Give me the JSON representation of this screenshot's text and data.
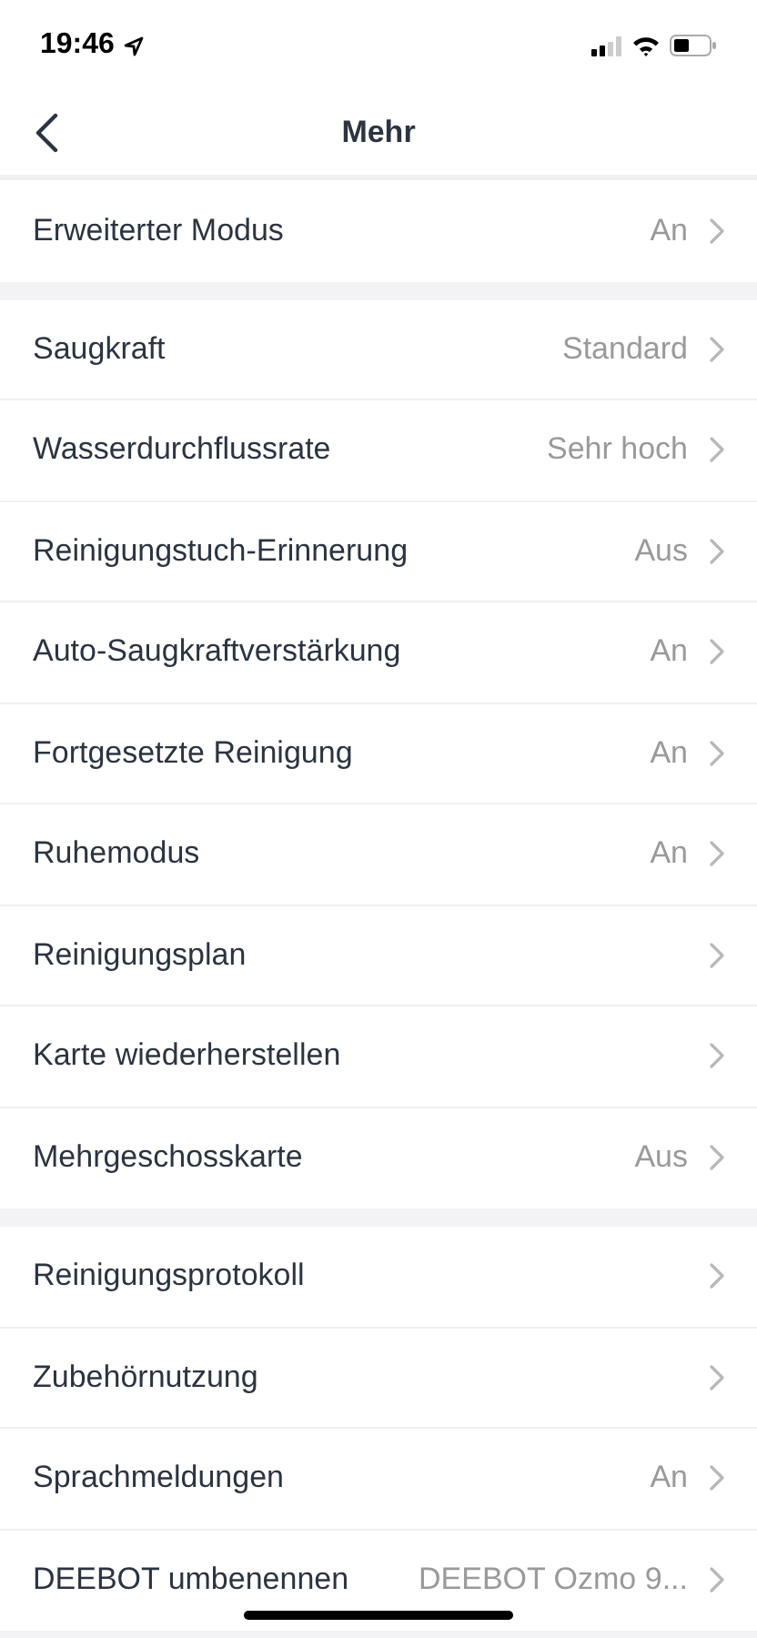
{
  "status_bar": {
    "time": "19:46"
  },
  "nav": {
    "title": "Mehr"
  },
  "groups": [
    {
      "rows": [
        {
          "label": "Erweiterter Modus",
          "value": "An"
        }
      ]
    },
    {
      "rows": [
        {
          "label": "Saugkraft",
          "value": "Standard"
        },
        {
          "label": "Wasserdurchflussrate",
          "value": "Sehr hoch"
        },
        {
          "label": "Reinigungstuch-Erinnerung",
          "value": "Aus"
        },
        {
          "label": "Auto-Saugkraftverstärkung",
          "value": "An"
        },
        {
          "label": "Fortgesetzte Reinigung",
          "value": "An"
        },
        {
          "label": "Ruhemodus",
          "value": "An"
        },
        {
          "label": "Reinigungsplan"
        },
        {
          "label": "Karte wiederherstellen"
        },
        {
          "label": "Mehrgeschosskarte",
          "value": "Aus"
        }
      ]
    },
    {
      "rows": [
        {
          "label": "Reinigungsprotokoll"
        },
        {
          "label": "Zubehörnutzung"
        },
        {
          "label": "Sprachmeldungen",
          "value": "An"
        },
        {
          "label": "DEEBOT umbenennen",
          "value": "DEEBOT Ozmo 9..."
        }
      ]
    }
  ]
}
